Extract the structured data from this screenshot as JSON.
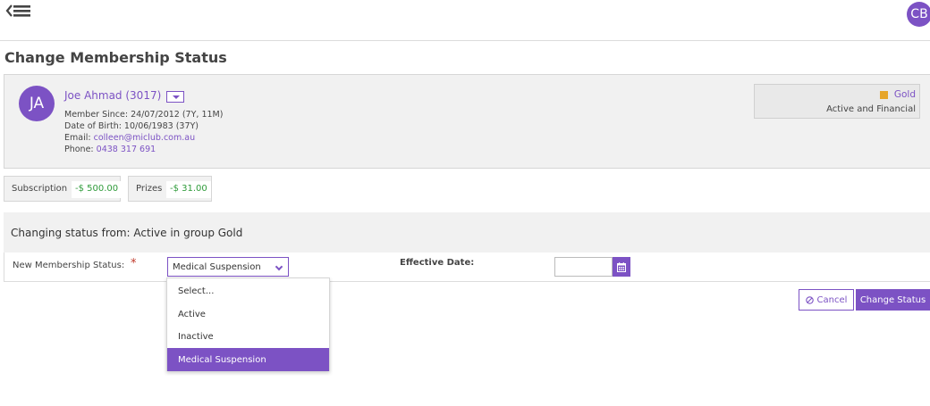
{
  "header": {
    "menu_icon": "back-menu-icon",
    "user_initials": "CB"
  },
  "page": {
    "title": "Change Membership Status"
  },
  "member": {
    "initials": "JA",
    "name": "Joe Ahmad (3017)",
    "member_since": "Member Since: 24/07/2012 (7Y, 11M)",
    "dob": "Date of Birth: 10/06/1983 (37Y)",
    "email_label": "Email:",
    "email": "colleen@miclub.com.au",
    "phone_label": "Phone:",
    "phone": "0438 317 691",
    "group": {
      "name": "Gold",
      "state": "Active and Financial",
      "swatch_color": "#e6a52a"
    }
  },
  "fees": [
    {
      "label": "Subscription",
      "value": "-$ 500.00"
    },
    {
      "label": "Prizes",
      "value": "-$ 31.00"
    }
  ],
  "status_change": {
    "heading": "Changing status from: Active in group Gold",
    "new_status_label": "New Membership Status:",
    "required_mark": "*",
    "selected_value": "Medical Suspension",
    "effective_date_label": "Effective Date:",
    "effective_date_value": "",
    "options": [
      "Select...",
      "Active",
      "Inactive",
      "Medical Suspension"
    ]
  },
  "actions": {
    "cancel_label": "Cancel",
    "change_label": "Change Status"
  },
  "colors": {
    "accent": "#7c52c4",
    "negative_amount": "#2f9b3a"
  }
}
